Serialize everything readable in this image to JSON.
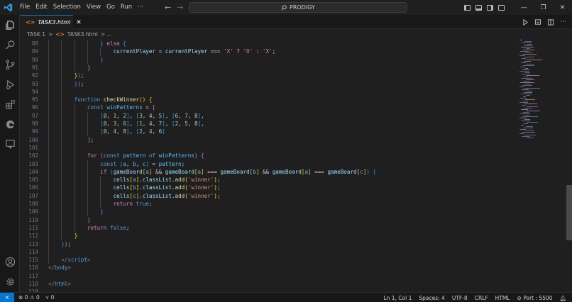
{
  "menu": [
    "File",
    "Edit",
    "Selection",
    "View",
    "Go",
    "Run",
    "···"
  ],
  "search": {
    "text": "PRODIGY"
  },
  "window_controls": {
    "minimize": "—",
    "restore": "❐",
    "close": "✕"
  },
  "tab": {
    "label": "TASK3.html",
    "icon": "<>",
    "close": "✕"
  },
  "breadcrumb": {
    "folder": "TASK 1",
    "sep": ">",
    "file_icon": "<>",
    "file": "TASK3.html",
    "tail": "> ..."
  },
  "status": {
    "errors": "0",
    "warnings": "0",
    "ports": "0",
    "position": "Ln 1, Col 1",
    "spaces": "Spaces: 4",
    "encoding": "UTF-8",
    "eol": "CRLF",
    "language": "HTML",
    "port": "Port : 5500"
  },
  "colors": {
    "accent": "#0078d4",
    "background": "#1f1f1f",
    "html_icon": "#e37933"
  },
  "code_lines": [
    {
      "n": "88",
      "indent": 16,
      "tokens": [
        [
          "b3",
          "} "
        ],
        [
          "ctl",
          "else"
        ],
        [
          "t",
          " "
        ],
        [
          "b3",
          "{"
        ]
      ]
    },
    {
      "n": "89",
      "indent": 20,
      "tokens": [
        [
          "var",
          "currentPlayer"
        ],
        [
          "t",
          " = "
        ],
        [
          "var",
          "currentPlayer"
        ],
        [
          "t",
          " === "
        ],
        [
          "str",
          "'X'"
        ],
        [
          "t",
          " ? "
        ],
        [
          "str",
          "'O'"
        ],
        [
          "t",
          " : "
        ],
        [
          "str",
          "'X'"
        ],
        [
          "t",
          ";"
        ]
      ]
    },
    {
      "n": "90",
      "indent": 16,
      "tokens": [
        [
          "b3",
          "}"
        ]
      ]
    },
    {
      "n": "91",
      "indent": 12,
      "tokens": [
        [
          "b2",
          "}"
        ]
      ]
    },
    {
      "n": "92",
      "indent": 8,
      "tokens": [
        [
          "b1",
          "}"
        ],
        [
          "b3",
          ")"
        ],
        [
          "t",
          ";"
        ]
      ]
    },
    {
      "n": "93",
      "indent": 8,
      "tokens": [
        [
          "b3",
          "}"
        ],
        [
          "b2",
          ")"
        ],
        [
          "t",
          ";"
        ]
      ]
    },
    {
      "n": "94",
      "indent": 0,
      "tokens": []
    },
    {
      "n": "95",
      "indent": 8,
      "tokens": [
        [
          "kw",
          "function"
        ],
        [
          "t",
          " "
        ],
        [
          "fn",
          "checkWinner"
        ],
        [
          "b1",
          "()"
        ],
        [
          "t",
          " "
        ],
        [
          "b1",
          "{"
        ]
      ]
    },
    {
      "n": "96",
      "indent": 12,
      "tokens": [
        [
          "kw",
          "const"
        ],
        [
          "t",
          " "
        ],
        [
          "cst",
          "winPatterns"
        ],
        [
          "t",
          " = "
        ],
        [
          "b2",
          "["
        ]
      ]
    },
    {
      "n": "97",
      "indent": 16,
      "tokens": [
        [
          "b3",
          "["
        ],
        [
          "num",
          "0"
        ],
        [
          "t",
          ", "
        ],
        [
          "num",
          "1"
        ],
        [
          "t",
          ", "
        ],
        [
          "num",
          "2"
        ],
        [
          "b3",
          "]"
        ],
        [
          "t",
          ", "
        ],
        [
          "b3",
          "["
        ],
        [
          "num",
          "3"
        ],
        [
          "t",
          ", "
        ],
        [
          "num",
          "4"
        ],
        [
          "t",
          ", "
        ],
        [
          "num",
          "5"
        ],
        [
          "b3",
          "]"
        ],
        [
          "t",
          ", "
        ],
        [
          "b3",
          "["
        ],
        [
          "num",
          "6"
        ],
        [
          "t",
          ", "
        ],
        [
          "num",
          "7"
        ],
        [
          "t",
          ", "
        ],
        [
          "num",
          "8"
        ],
        [
          "b3",
          "]"
        ],
        [
          "t",
          ","
        ]
      ]
    },
    {
      "n": "98",
      "indent": 16,
      "tokens": [
        [
          "b3",
          "["
        ],
        [
          "num",
          "0"
        ],
        [
          "t",
          ", "
        ],
        [
          "num",
          "3"
        ],
        [
          "t",
          ", "
        ],
        [
          "num",
          "6"
        ],
        [
          "b3",
          "]"
        ],
        [
          "t",
          ", "
        ],
        [
          "b3",
          "["
        ],
        [
          "num",
          "1"
        ],
        [
          "t",
          ", "
        ],
        [
          "num",
          "4"
        ],
        [
          "t",
          ", "
        ],
        [
          "num",
          "7"
        ],
        [
          "b3",
          "]"
        ],
        [
          "t",
          ", "
        ],
        [
          "b3",
          "["
        ],
        [
          "num",
          "2"
        ],
        [
          "t",
          ", "
        ],
        [
          "num",
          "5"
        ],
        [
          "t",
          ", "
        ],
        [
          "num",
          "8"
        ],
        [
          "b3",
          "]"
        ],
        [
          "t",
          ","
        ]
      ]
    },
    {
      "n": "99",
      "indent": 16,
      "tokens": [
        [
          "b3",
          "["
        ],
        [
          "num",
          "0"
        ],
        [
          "t",
          ", "
        ],
        [
          "num",
          "4"
        ],
        [
          "t",
          ", "
        ],
        [
          "num",
          "8"
        ],
        [
          "b3",
          "]"
        ],
        [
          "t",
          ", "
        ],
        [
          "b3",
          "["
        ],
        [
          "num",
          "2"
        ],
        [
          "t",
          ", "
        ],
        [
          "num",
          "4"
        ],
        [
          "t",
          ", "
        ],
        [
          "num",
          "6"
        ],
        [
          "b3",
          "]"
        ]
      ]
    },
    {
      "n": "100",
      "indent": 12,
      "tokens": [
        [
          "b2",
          "]"
        ],
        [
          "t",
          ";"
        ]
      ]
    },
    {
      "n": "101",
      "indent": 0,
      "tokens": []
    },
    {
      "n": "102",
      "indent": 12,
      "tokens": [
        [
          "ctl",
          "for"
        ],
        [
          "t",
          " "
        ],
        [
          "b2",
          "("
        ],
        [
          "kw",
          "const"
        ],
        [
          "t",
          " "
        ],
        [
          "cst",
          "pattern"
        ],
        [
          "t",
          " "
        ],
        [
          "kw",
          "of"
        ],
        [
          "t",
          " "
        ],
        [
          "cst",
          "winPatterns"
        ],
        [
          "b2",
          ")"
        ],
        [
          "t",
          " "
        ],
        [
          "b2",
          "{"
        ]
      ]
    },
    {
      "n": "103",
      "indent": 16,
      "tokens": [
        [
          "kw",
          "const"
        ],
        [
          "t",
          " "
        ],
        [
          "b3",
          "["
        ],
        [
          "cst",
          "a"
        ],
        [
          "t",
          ", "
        ],
        [
          "cst",
          "b"
        ],
        [
          "t",
          ", "
        ],
        [
          "cst",
          "c"
        ],
        [
          "b3",
          "]"
        ],
        [
          "t",
          " = "
        ],
        [
          "cst",
          "pattern"
        ],
        [
          "t",
          ";"
        ]
      ]
    },
    {
      "n": "104",
      "indent": 16,
      "tokens": [
        [
          "ctl",
          "if"
        ],
        [
          "t",
          " "
        ],
        [
          "b3",
          "("
        ],
        [
          "var",
          "gameBoard"
        ],
        [
          "b1",
          "["
        ],
        [
          "cst",
          "a"
        ],
        [
          "b1",
          "]"
        ],
        [
          "t",
          " && "
        ],
        [
          "var",
          "gameBoard"
        ],
        [
          "b1",
          "["
        ],
        [
          "cst",
          "a"
        ],
        [
          "b1",
          "]"
        ],
        [
          "t",
          " === "
        ],
        [
          "var",
          "gameBoard"
        ],
        [
          "b1",
          "["
        ],
        [
          "cst",
          "b"
        ],
        [
          "b1",
          "]"
        ],
        [
          "t",
          " && "
        ],
        [
          "var",
          "gameBoard"
        ],
        [
          "b1",
          "["
        ],
        [
          "cst",
          "a"
        ],
        [
          "b1",
          "]"
        ],
        [
          "t",
          " === "
        ],
        [
          "var",
          "gameBoard"
        ],
        [
          "b1",
          "["
        ],
        [
          "cst",
          "c"
        ],
        [
          "b1",
          "]"
        ],
        [
          "b3",
          ")"
        ],
        [
          "t",
          " "
        ],
        [
          "b3",
          "{"
        ]
      ]
    },
    {
      "n": "105",
      "indent": 20,
      "tokens": [
        [
          "var",
          "cells"
        ],
        [
          "b1",
          "["
        ],
        [
          "cst",
          "a"
        ],
        [
          "b1",
          "]"
        ],
        [
          "t",
          "."
        ],
        [
          "var",
          "classList"
        ],
        [
          "t",
          "."
        ],
        [
          "fn",
          "add"
        ],
        [
          "b1",
          "("
        ],
        [
          "str",
          "'winner'"
        ],
        [
          "b1",
          ")"
        ],
        [
          "t",
          ";"
        ]
      ]
    },
    {
      "n": "106",
      "indent": 20,
      "tokens": [
        [
          "var",
          "cells"
        ],
        [
          "b1",
          "["
        ],
        [
          "cst",
          "b"
        ],
        [
          "b1",
          "]"
        ],
        [
          "t",
          "."
        ],
        [
          "var",
          "classList"
        ],
        [
          "t",
          "."
        ],
        [
          "fn",
          "add"
        ],
        [
          "b1",
          "("
        ],
        [
          "str",
          "'winner'"
        ],
        [
          "b1",
          ")"
        ],
        [
          "t",
          ";"
        ]
      ]
    },
    {
      "n": "107",
      "indent": 20,
      "tokens": [
        [
          "var",
          "cells"
        ],
        [
          "b1",
          "["
        ],
        [
          "cst",
          "c"
        ],
        [
          "b1",
          "]"
        ],
        [
          "t",
          "."
        ],
        [
          "var",
          "classList"
        ],
        [
          "t",
          "."
        ],
        [
          "fn",
          "add"
        ],
        [
          "b1",
          "("
        ],
        [
          "str",
          "'winner'"
        ],
        [
          "b1",
          ")"
        ],
        [
          "t",
          ";"
        ]
      ]
    },
    {
      "n": "108",
      "indent": 20,
      "tokens": [
        [
          "ctl",
          "return"
        ],
        [
          "t",
          " "
        ],
        [
          "kw",
          "true"
        ],
        [
          "t",
          ";"
        ]
      ]
    },
    {
      "n": "109",
      "indent": 16,
      "tokens": [
        [
          "b3",
          "}"
        ]
      ]
    },
    {
      "n": "110",
      "indent": 12,
      "tokens": [
        [
          "b2",
          "}"
        ]
      ]
    },
    {
      "n": "111",
      "indent": 12,
      "tokens": [
        [
          "ctl",
          "return"
        ],
        [
          "t",
          " "
        ],
        [
          "kw",
          "false"
        ],
        [
          "t",
          ";"
        ]
      ]
    },
    {
      "n": "112",
      "indent": 8,
      "tokens": [
        [
          "b1",
          "}"
        ]
      ]
    },
    {
      "n": "113",
      "indent": 4,
      "tokens": [
        [
          "b3",
          "}"
        ],
        [
          "b2",
          ")"
        ],
        [
          "t",
          ";"
        ]
      ]
    },
    {
      "n": "114",
      "indent": 0,
      "tokens": []
    },
    {
      "n": "115",
      "indent": 4,
      "tokens": [
        [
          "tagp",
          "</"
        ],
        [
          "tag",
          "script"
        ],
        [
          "tagp",
          ">"
        ]
      ]
    },
    {
      "n": "116",
      "indent": 0,
      "tokens": [
        [
          "tagp",
          "</"
        ],
        [
          "tag",
          "body"
        ],
        [
          "tagp",
          ">"
        ]
      ]
    },
    {
      "n": "117",
      "indent": 0,
      "tokens": []
    },
    {
      "n": "118",
      "indent": 0,
      "tokens": [
        [
          "tagp",
          "</"
        ],
        [
          "tag",
          "html"
        ],
        [
          "tagp",
          ">"
        ]
      ]
    },
    {
      "n": "119",
      "indent": 0,
      "tokens": []
    }
  ]
}
